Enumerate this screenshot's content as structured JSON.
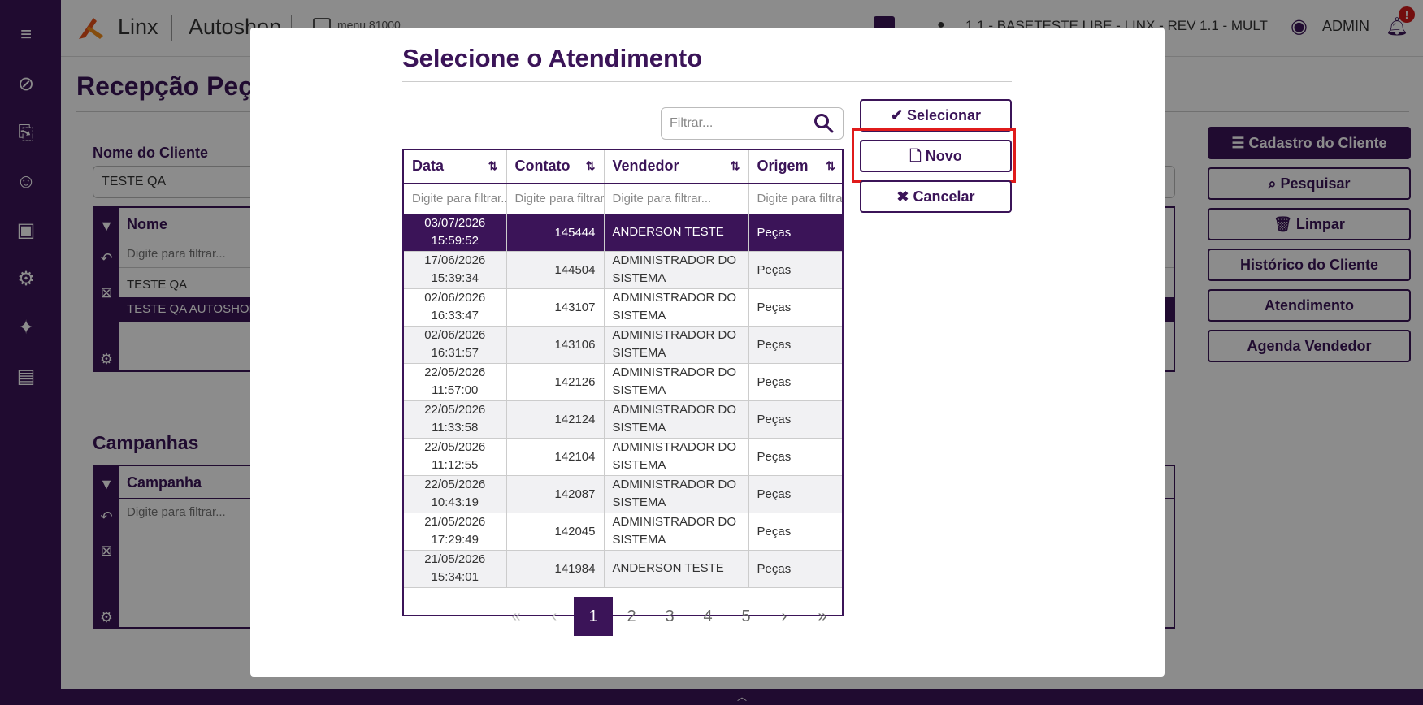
{
  "app": {
    "brand1": "Linx",
    "brand2": "Autoshop",
    "menu_search": "menu 81000",
    "env_text": "1.1 - BASETESTE LIBE - LINX - REV 1.1 - MULT",
    "user": "ADMIN",
    "notif_badge": "!"
  },
  "sidebar": {
    "items": [
      "menu-icon",
      "compass-icon",
      "clipboard-transfer-icon",
      "user-search-icon",
      "monitor-icon",
      "gear-icon",
      "sparkle-icon",
      "clipboard-icon"
    ]
  },
  "page": {
    "title": "Recepção Peças",
    "cliente_label": "Nome do Cliente",
    "cliente_value": "TESTE QA",
    "grid_header": "Nome",
    "grid_filter": "Digite para filtrar...",
    "grid_rows": [
      "TESTE QA",
      "TESTE QA AUTOSHOP"
    ],
    "campanhas_title": "Campanhas",
    "campanha_header": "Campanha",
    "campanha_filter": "Digite para filtrar..."
  },
  "side_buttons": [
    "Cadastro do Cliente",
    "Pesquisar",
    "Limpar",
    "Histórico do Cliente",
    "Atendimento",
    "Agenda Vendedor"
  ],
  "modal": {
    "title": "Selecione o Atendimento",
    "filter_placeholder": "Filtrar...",
    "columns": [
      "Data",
      "Contato",
      "Vendedor",
      "Origem"
    ],
    "column_filters": [
      "Digite para filtrar...",
      "Digite para filtrar...",
      "Digite para filtrar...",
      "Digite para filtrar..."
    ],
    "rows": [
      {
        "date": "03/07/2026",
        "time": "15:59:52",
        "contato": "145444",
        "vendedor": "ANDERSON TESTE",
        "origem": "Peças"
      },
      {
        "date": "17/06/2026",
        "time": "15:39:34",
        "contato": "144504",
        "vendedor": "ADMINISTRADOR DO SISTEMA",
        "origem": "Peças"
      },
      {
        "date": "02/06/2026",
        "time": "16:33:47",
        "contato": "143107",
        "vendedor": "ADMINISTRADOR DO SISTEMA",
        "origem": "Peças"
      },
      {
        "date": "02/06/2026",
        "time": "16:31:57",
        "contato": "143106",
        "vendedor": "ADMINISTRADOR DO SISTEMA",
        "origem": "Peças"
      },
      {
        "date": "22/05/2026",
        "time": "11:57:00",
        "contato": "142126",
        "vendedor": "ADMINISTRADOR DO SISTEMA",
        "origem": "Peças"
      },
      {
        "date": "22/05/2026",
        "time": "11:33:58",
        "contato": "142124",
        "vendedor": "ADMINISTRADOR DO SISTEMA",
        "origem": "Peças"
      },
      {
        "date": "22/05/2026",
        "time": "11:12:55",
        "contato": "142104",
        "vendedor": "ADMINISTRADOR DO SISTEMA",
        "origem": "Peças"
      },
      {
        "date": "22/05/2026",
        "time": "10:43:19",
        "contato": "142087",
        "vendedor": "ADMINISTRADOR DO SISTEMA",
        "origem": "Peças"
      },
      {
        "date": "21/05/2026",
        "time": "17:29:49",
        "contato": "142045",
        "vendedor": "ADMINISTRADOR DO SISTEMA",
        "origem": "Peças"
      },
      {
        "date": "21/05/2026",
        "time": "15:34:01",
        "contato": "141984",
        "vendedor": "ANDERSON TESTE",
        "origem": "Peças"
      }
    ],
    "buttons": {
      "selecionar": "Selecionar",
      "novo": "Novo",
      "cancelar": "Cancelar"
    },
    "pages": [
      "1",
      "2",
      "3",
      "4",
      "5"
    ],
    "current_page": "1",
    "pager_first": "«",
    "pager_prev": "‹",
    "pager_next": "›",
    "pager_last": "»"
  },
  "colors": {
    "brand_purple": "#3b1458",
    "highlight_red": "#e01b1b"
  }
}
